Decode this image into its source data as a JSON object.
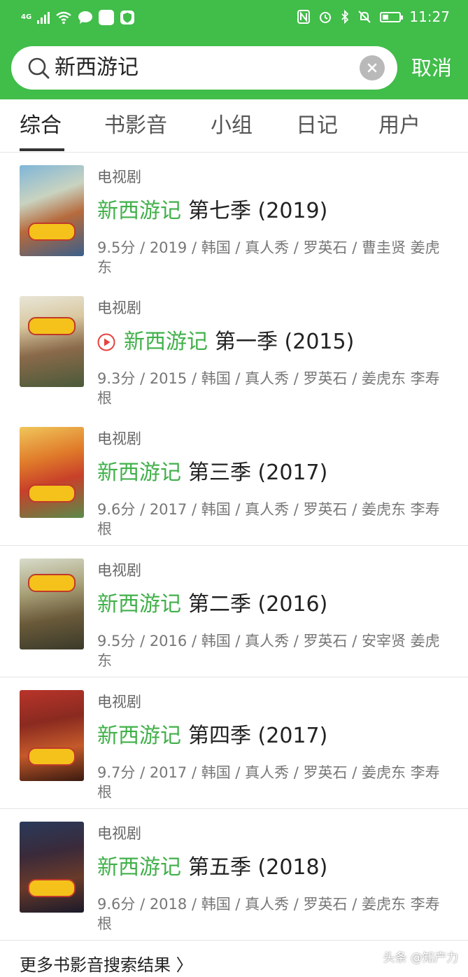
{
  "status_bar": {
    "network": "4G",
    "time": "11:27"
  },
  "search": {
    "query": "新西游记",
    "cancel_label": "取消"
  },
  "tabs": [
    {
      "label": "综合"
    },
    {
      "label": "书影音"
    },
    {
      "label": "小组"
    },
    {
      "label": "日记"
    },
    {
      "label": "用户"
    }
  ],
  "results": [
    {
      "category": "电视剧",
      "highlight": "新西游记",
      "title": "第七季 (2019)",
      "meta": "9.5分 / 2019 / 韩国 / 真人秀 / 罗英石 / 曹圭贤 姜虎东",
      "playable": false
    },
    {
      "category": "电视剧",
      "highlight": "新西游记",
      "title": "第一季 (2015)",
      "meta": "9.3分 / 2015 / 韩国 / 真人秀 / 罗英石 / 姜虎东 李寿根",
      "playable": true
    },
    {
      "category": "电视剧",
      "highlight": "新西游记",
      "title": "第三季 (2017)",
      "meta": "9.6分 / 2017 / 韩国 / 真人秀 / 罗英石 / 姜虎东 李寿根",
      "playable": false
    },
    {
      "category": "电视剧",
      "highlight": "新西游记",
      "title": "第二季 (2016)",
      "meta": "9.5分 / 2016 / 韩国 / 真人秀 / 罗英石 / 安宰贤 姜虎东",
      "playable": false
    },
    {
      "category": "电视剧",
      "highlight": "新西游记",
      "title": "第四季 (2017)",
      "meta": "9.7分 / 2017 / 韩国 / 真人秀 / 罗英石 / 姜虎东 李寿根",
      "playable": false
    },
    {
      "category": "电视剧",
      "highlight": "新西游记",
      "title": "第五季 (2018)",
      "meta": "9.6分 / 2018 / 韩国 / 真人秀 / 罗英石 / 姜虎东 李寿根",
      "playable": false
    }
  ],
  "more_results": "更多书影音搜索结果 〉",
  "watermark": "头条 @知产力",
  "colors": {
    "brand_green": "#41bd4a",
    "highlight_green": "#41b04a",
    "play_red": "#e64340"
  }
}
